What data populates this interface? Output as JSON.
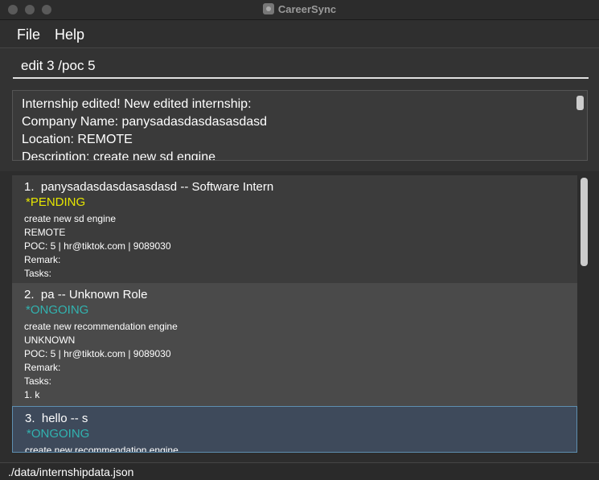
{
  "window": {
    "title": "CareerSync"
  },
  "menu": {
    "file": "File",
    "help": "Help"
  },
  "command": {
    "value": "edit 3 /poc 5"
  },
  "result": {
    "lines": [
      "Internship edited! New edited internship:",
      "Company Name: panysadasdasdasasdasd",
      "Location: REMOTE",
      "Description: create new sd engine"
    ]
  },
  "internships": [
    {
      "index": "1.",
      "title": "panysadasdasdasasdasd -- Software Intern",
      "status": "*PENDING",
      "description": "create new sd engine",
      "location": "REMOTE",
      "poc": "POC: 5 | hr@tiktok.com | 9089030",
      "remark": "Remark:",
      "tasks_label": "Tasks:",
      "tasks": []
    },
    {
      "index": "2.",
      "title": "pa -- Unknown Role",
      "status": "*ONGOING",
      "description": "create new recommendation engine",
      "location": "UNKNOWN",
      "poc": "POC: 5 | hr@tiktok.com | 9089030",
      "remark": "Remark:",
      "tasks_label": "Tasks:",
      "tasks": [
        "1. k"
      ]
    },
    {
      "index": "3.",
      "title": "hello -- s",
      "status": "*ONGOING",
      "description": "create new recommendation engine"
    }
  ],
  "statusbar": {
    "path": "./data/internshipdata.json"
  },
  "colors": {
    "pending": "#e6e600",
    "ongoing": "#31b3b0",
    "selected_border": "#5e8fb0"
  }
}
